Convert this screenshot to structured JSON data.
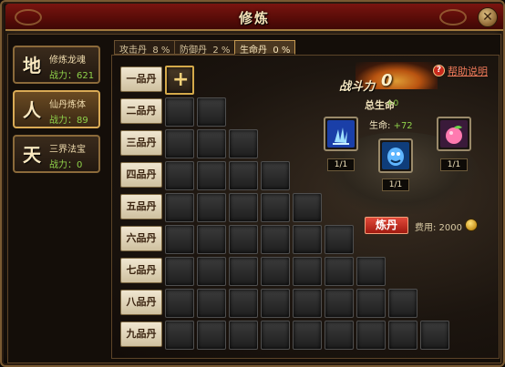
{
  "window": {
    "title": "修炼",
    "close_label": "✕"
  },
  "side_tabs": [
    {
      "char": "地",
      "name": "修炼龙魂",
      "power": "战力：621",
      "active": false
    },
    {
      "char": "人",
      "name": "仙丹炼体",
      "power": "战力：89",
      "active": true
    },
    {
      "char": "天",
      "name": "三界法宝",
      "power": "战力：0",
      "active": false
    }
  ],
  "top_tabs": [
    {
      "label": "攻击丹",
      "pct": "8 %"
    },
    {
      "label": "防御丹",
      "pct": "2 %"
    },
    {
      "label": "生命丹",
      "pct": "0 %",
      "active": true
    }
  ],
  "rows": [
    "一品丹",
    "二品丹",
    "三品丹",
    "四品丹",
    "五品丹",
    "六品丹",
    "七品丹",
    "八品丹",
    "九品丹"
  ],
  "panel": {
    "power_label": "战斗力",
    "power_value": "0",
    "help": "帮助说明",
    "total_label": "总生命",
    "total_value": "+0",
    "life_label": "生命:",
    "life_value": "+72",
    "items": [
      {
        "name": "blue-herb",
        "count": "1/1"
      },
      {
        "name": "blue-beast",
        "count": "1/1"
      },
      {
        "name": "peach",
        "count": "1/1"
      }
    ],
    "refine_label": "炼丹",
    "cost_label": "费用: 2000"
  }
}
